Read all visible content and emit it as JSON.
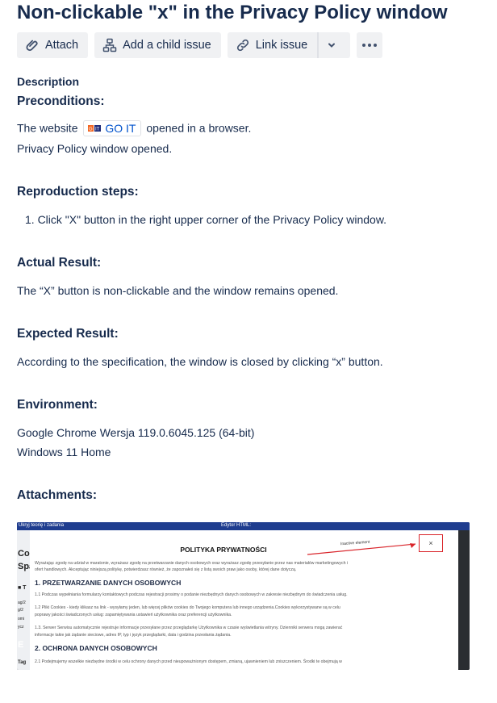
{
  "issue": {
    "title": "Non-clickable \"x\" in the Privacy Policy window"
  },
  "toolbar": {
    "attach": "Attach",
    "add_child": "Add a child issue",
    "link_issue": "Link issue"
  },
  "description": {
    "label": "Description",
    "preconditions_heading": "Preconditions:",
    "pre_line1_before": "The website",
    "smart_link": "GO IT",
    "pre_line1_after": "opened in a browser.",
    "pre_line2": "Privacy Policy window opened.",
    "repro_heading": "Reproduction steps:",
    "repro_steps": [
      "1. Click \"X\" button in the right upper corner of the Privacy Policy window."
    ],
    "actual_heading": "Actual Result:",
    "actual_text": "The “X” button is non-clickable and the window remains opened.",
    "expected_heading": "Expected Result:",
    "expected_text": "According to the specification, the window is closed by clicking “x” button.",
    "env_heading": "Environment:",
    "env_line1": "Google Chrome Wersja 119.0.6045.125 (64-bit)",
    "env_line2": "Windows 11 Home",
    "attachments_heading": "Attachments:"
  },
  "attachment": {
    "top_left_tab": "Ukryj teorię i zadania",
    "top_right_tab": "Edytor HTML:",
    "left_fragments": [
      "Co",
      "Spa",
      "■ T",
      "ag/2",
      "g/2",
      "omi",
      "ycz",
      "E",
      "Tag"
    ],
    "modal_title": "POLITYKA PRYWATNOŚCI",
    "close_glyph": "×",
    "annotation": "Inactive element",
    "intro_1": "Wyrażając zgodę na udział w maratonie, wyrażasz zgodę na przetwarzanie danych osobowych oraz wyrażasz zgodę przesyłanie przez nas materiałów marketingowych i",
    "intro_2": "ofert handlowych. Akceptując niniejszą politykę, potwierdzasz również, że zapoznałeś się z listą swoich praw jako osoby, której dane dotyczą.",
    "section1": "1. PRZETWARZANIE DANYCH OSOBOWYCH",
    "s1_1": "1.1 Podczas wypełniania formularzy kontaktowych podczas rejestracji prosimy o podanie niezbędnych danych osobowych w zakresie niezbędnym do świadczenia usług.",
    "s1_2a": "1.2 Pliki Cookies - kiedy klikasz na link - wysyłamy jeden, lub więcej plików cookies do Twojego komputera lub innego urządzenia.Cookies wykorzystywane są w celu",
    "s1_2b": "poprawy jakości świadczonych usług: zapamiętywania ustawień użytkownika oraz preferencji użytkownika.",
    "s1_3a": "1.3. Serwer Serwisu automatycznie rejestruje informacje przesyłane przez przeglądarkę Użytkownika w czasie wyświetlania witryny. Dzienniki serwera mogą zawierać",
    "s1_3b": "informacje takie jak żądanie sieciowe, adres IP, typ i język przeglądarki, data i godzina przesłania żądania.",
    "section2": "2. OCHRONA DANYCH OSOBOWYCH",
    "s2_1": "2.1 Podejmujemy wszelkie niezbędne środki w celu ochrony danych przed nieupoważnionym dostępem, zmianą, ujawnieniem lub zniszczeniem. Środki te obejmują w"
  }
}
